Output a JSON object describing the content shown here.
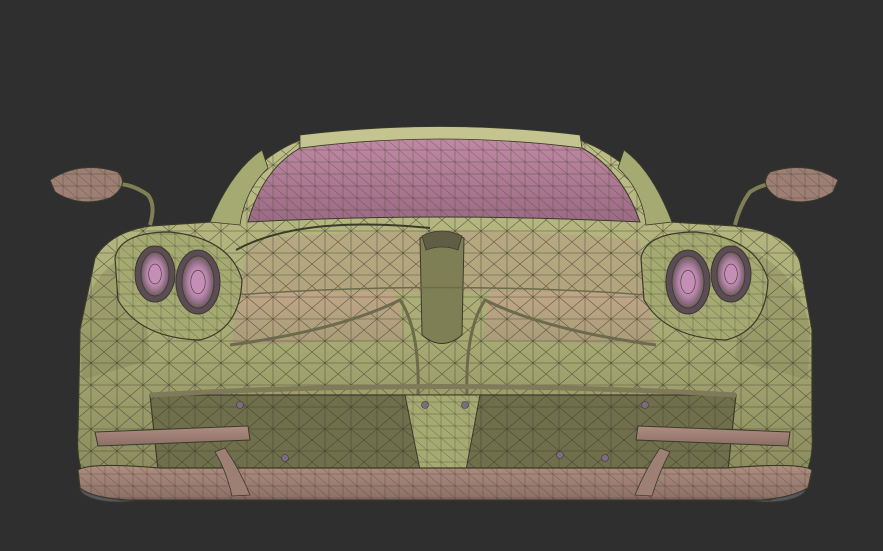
{
  "viewport": {
    "background_color": "#2f2f2f"
  },
  "model": {
    "subject": "hypercar-front-view",
    "render_mode": "wireframe-shaded",
    "colors": {
      "body": "#a5aa72",
      "body_dark": "#7e7f55",
      "body_light": "#c3c48f",
      "glass": "#b57e98",
      "glass_dark": "#8f5e77",
      "hood_panel": "#b89a86",
      "lamp_core": "#c58eb6",
      "splitter": "#9e7f74",
      "grille": "#6f6f4c",
      "wire": "#3b3b2a",
      "tire": "#555562"
    }
  }
}
